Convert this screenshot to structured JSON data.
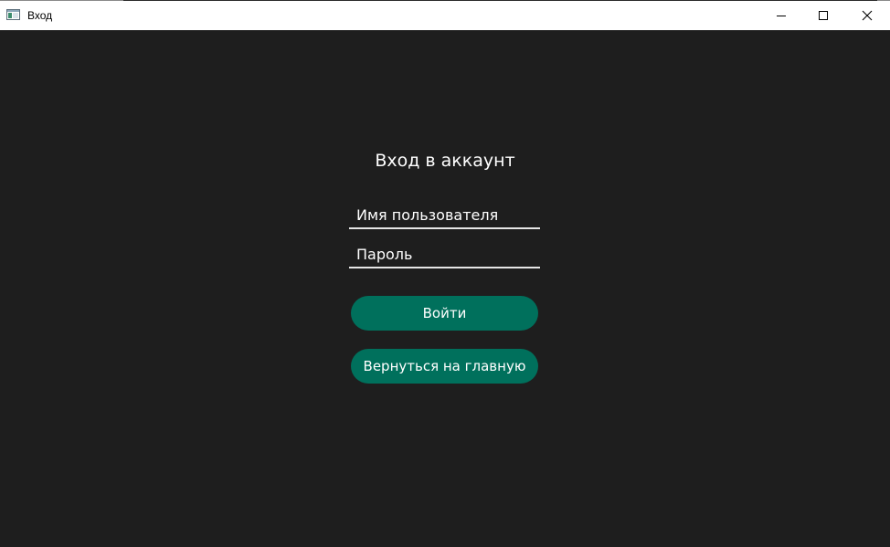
{
  "window": {
    "title": "Вход"
  },
  "titlebar_icons": {
    "app": "app-window-icon",
    "minimize": "minimize-icon",
    "maximize": "maximize-icon",
    "close": "close-icon"
  },
  "login_form": {
    "heading": "Вход в аккаунт",
    "username_placeholder": "Имя пользователя",
    "password_placeholder": "Пароль",
    "login_button": "Войти",
    "back_button": "Вернуться на главную"
  },
  "colors": {
    "background": "#1e1e1e",
    "accent": "#00705c",
    "text": "#ffffff"
  }
}
